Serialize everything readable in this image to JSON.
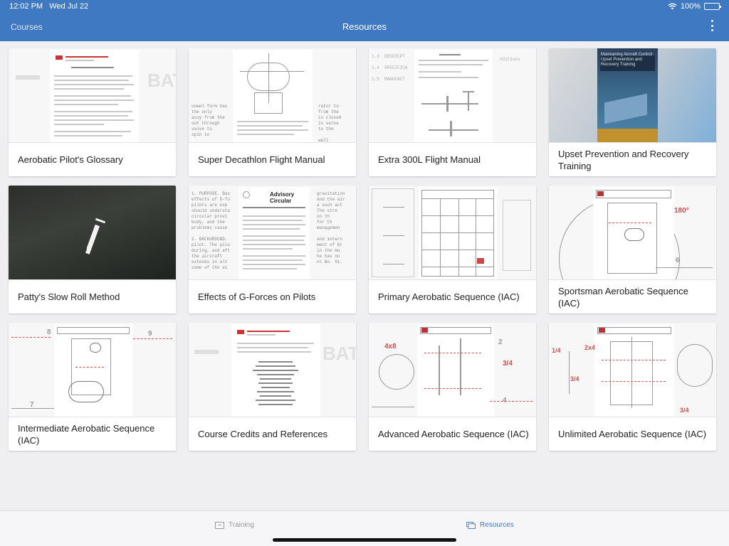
{
  "status_bar": {
    "time": "12:02 PM",
    "date": "Wed Jul 22",
    "battery": "100%"
  },
  "nav": {
    "back_label": "Courses",
    "title": "Resources"
  },
  "resources": [
    {
      "title": "Aerobatic Pilot's Glossary"
    },
    {
      "title": "Super Decathlon Flight Manual"
    },
    {
      "title": "Extra 300L Flight Manual"
    },
    {
      "title": "Upset Prevention and Recovery Training"
    },
    {
      "title": "Patty's Slow Roll Method"
    },
    {
      "title": "Effects of G-Forces on Pilots"
    },
    {
      "title": "Primary Aerobatic Sequence (IAC)"
    },
    {
      "title": "Sportsman Aerobatic Sequence (IAC)"
    },
    {
      "title": "Intermediate Aerobatic Sequence (IAC)"
    },
    {
      "title": "Course Credits and References"
    },
    {
      "title": "Advanced Aerobatic Sequence (IAC)"
    },
    {
      "title": "Unlimited Aerobatic Sequence (IAC)"
    }
  ],
  "tabs": {
    "training": "Training",
    "resources": "Resources"
  },
  "colors": {
    "accent": "#3e79c2",
    "background": "#efeff2",
    "inactive_tab": "#9a9aa0"
  },
  "icons": [
    "wifi-icon",
    "battery-icon",
    "more-vertical-icon",
    "training-icon",
    "resources-icon"
  ]
}
